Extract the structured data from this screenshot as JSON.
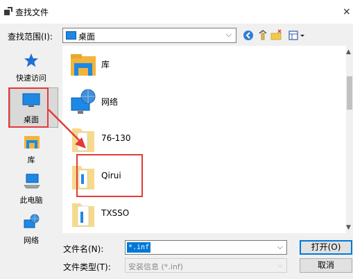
{
  "dialog": {
    "title": "查找文件",
    "close_glyph": "×"
  },
  "toolbar": {
    "lookin_label": "查找范围(I):",
    "lookin_value": "桌面",
    "dropdown_glyph": "⌵"
  },
  "places": [
    {
      "label": "快速访问",
      "icon": "star-icon"
    },
    {
      "label": "桌面",
      "icon": "desktop-icon"
    },
    {
      "label": "库",
      "icon": "library-icon"
    },
    {
      "label": "此电脑",
      "icon": "computer-icon"
    },
    {
      "label": "网络",
      "icon": "network-icon"
    }
  ],
  "files": [
    {
      "name": "库",
      "icon": "library-icon"
    },
    {
      "name": "网络",
      "icon": "network-icon"
    },
    {
      "name": "76-130",
      "icon": "folder-icon"
    },
    {
      "name": "Qirui",
      "icon": "folder-icon"
    },
    {
      "name": "TXSSO",
      "icon": "folder-icon"
    }
  ],
  "footer": {
    "filename_label": "文件名(N):",
    "filename_value": "*.inf",
    "filetype_label": "文件类型(T):",
    "filetype_value": "安装信息 (*.inf)",
    "open_label": "打开(O)",
    "cancel_label": "取消"
  },
  "colors": {
    "highlight": "#e53935",
    "selection": "#0078d7"
  }
}
